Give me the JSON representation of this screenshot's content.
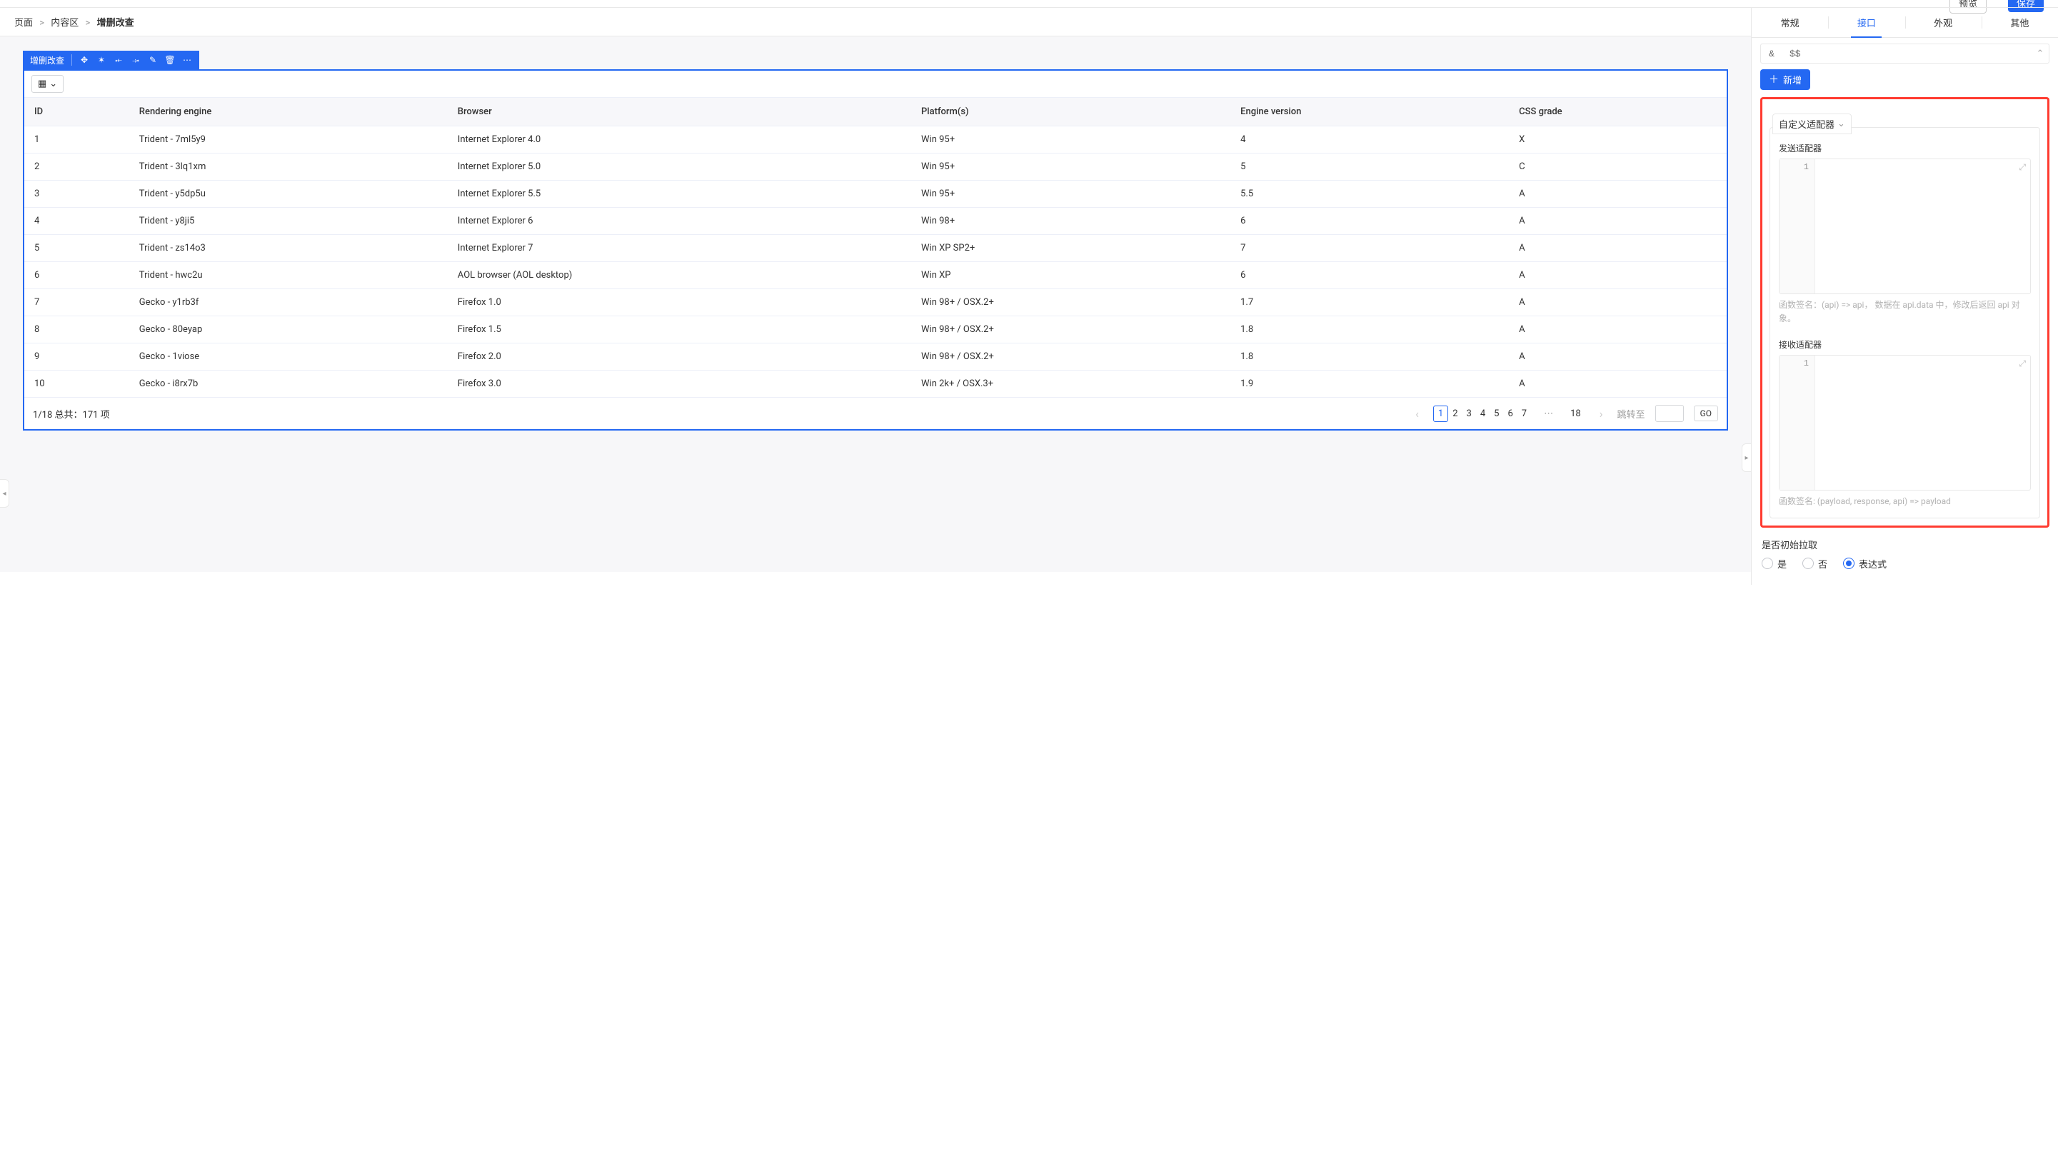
{
  "top": {
    "preview": "预览",
    "save": "保存"
  },
  "breadcrumb": {
    "items": [
      "页面",
      "内容区",
      "增删改查"
    ],
    "sep": ">"
  },
  "component": {
    "name": "增删改查"
  },
  "table": {
    "headers": [
      "ID",
      "Rendering engine",
      "Browser",
      "Platform(s)",
      "Engine version",
      "CSS grade"
    ],
    "rows": [
      [
        "1",
        "Trident - 7ml5y9",
        "Internet Explorer 4.0",
        "Win 95+",
        "4",
        "X"
      ],
      [
        "2",
        "Trident - 3lq1xm",
        "Internet Explorer 5.0",
        "Win 95+",
        "5",
        "C"
      ],
      [
        "3",
        "Trident - y5dp5u",
        "Internet Explorer 5.5",
        "Win 95+",
        "5.5",
        "A"
      ],
      [
        "4",
        "Trident - y8ji5",
        "Internet Explorer 6",
        "Win 98+",
        "6",
        "A"
      ],
      [
        "5",
        "Trident - zs14o3",
        "Internet Explorer 7",
        "Win XP SP2+",
        "7",
        "A"
      ],
      [
        "6",
        "Trident - hwc2u",
        "AOL browser (AOL desktop)",
        "Win XP",
        "6",
        "A"
      ],
      [
        "7",
        "Gecko - y1rb3f",
        "Firefox 1.0",
        "Win 98+ / OSX.2+",
        "1.7",
        "A"
      ],
      [
        "8",
        "Gecko - 80eyap",
        "Firefox 1.5",
        "Win 98+ / OSX.2+",
        "1.8",
        "A"
      ],
      [
        "9",
        "Gecko - 1viose",
        "Firefox 2.0",
        "Win 98+ / OSX.2+",
        "1.8",
        "A"
      ],
      [
        "10",
        "Gecko - i8rx7b",
        "Firefox 3.0",
        "Win 2k+ / OSX.3+",
        "1.9",
        "A"
      ]
    ]
  },
  "pager": {
    "summary_prefix": "1/18 总共：",
    "total_text": "171 项",
    "pages": [
      "1",
      "2",
      "3",
      "4",
      "5",
      "6",
      "7"
    ],
    "last_page": "18",
    "jump_label": "跳转至",
    "go": "GO"
  },
  "panel": {
    "tabs": [
      "常规",
      "接口",
      "外观",
      "其他"
    ],
    "active_index": 1,
    "small_row": {
      "left": "&",
      "mid": "$$"
    },
    "add_btn": "新增",
    "fieldset_title": "自定义适配器",
    "send_adapter_label": "发送适配器",
    "recv_adapter_label": "接收适配器",
    "gutter_line": "1",
    "send_hint": "函数签名：(api) => api，  数据在 api.data 中，修改后返回 api 对象。",
    "recv_hint": "函数签名: (payload, response, api) => payload",
    "initial_fetch_q": "是否初始拉取",
    "radios": [
      "是",
      "否",
      "表达式"
    ],
    "radio_checked_index": 2
  }
}
